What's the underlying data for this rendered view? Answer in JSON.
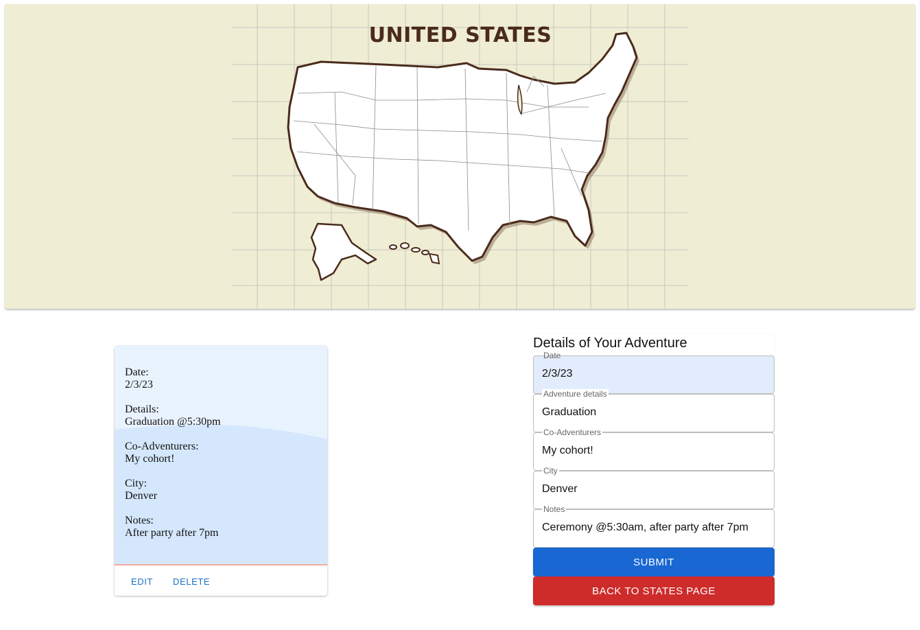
{
  "banner": {
    "map_title": "UNITED STATES",
    "map_image": "united-states-outline-map"
  },
  "adventure_card": {
    "fields": [
      {
        "label": "Date:",
        "value": "2/3/23"
      },
      {
        "label": "Details:",
        "value": "Graduation @5:30pm"
      },
      {
        "label": "Co-Adventurers:",
        "value": "My cohort!"
      },
      {
        "label": "City:",
        "value": "Denver"
      },
      {
        "label": "Notes:",
        "value": "After party after 7pm"
      }
    ],
    "actions": {
      "edit": "EDIT",
      "delete": "DELETE"
    }
  },
  "form": {
    "title": "Details of Your Adventure",
    "fields": {
      "date": {
        "label": "Date",
        "value": "2/3/23"
      },
      "details": {
        "label": "Adventure details",
        "value": "Graduation"
      },
      "co_adventurers": {
        "label": "Co-Adventurers",
        "value": "My cohort!"
      },
      "city": {
        "label": "City",
        "value": "Denver"
      },
      "notes": {
        "label": "Notes",
        "value": "Ceremony @5:30am, after party after 7pm"
      }
    },
    "submit_label": "SUBMIT",
    "back_label": "BACK TO STATES PAGE"
  },
  "colors": {
    "banner_bg": "#efedd4",
    "map_title": "#4a2b1b",
    "card_bg": "#e9f3fe",
    "card_wave": "#d5e7fc",
    "link_blue": "#1a6fc4",
    "submit_blue": "#1967d2",
    "back_red": "#ce2b2b",
    "date_field_bg": "#e3ecfc"
  }
}
